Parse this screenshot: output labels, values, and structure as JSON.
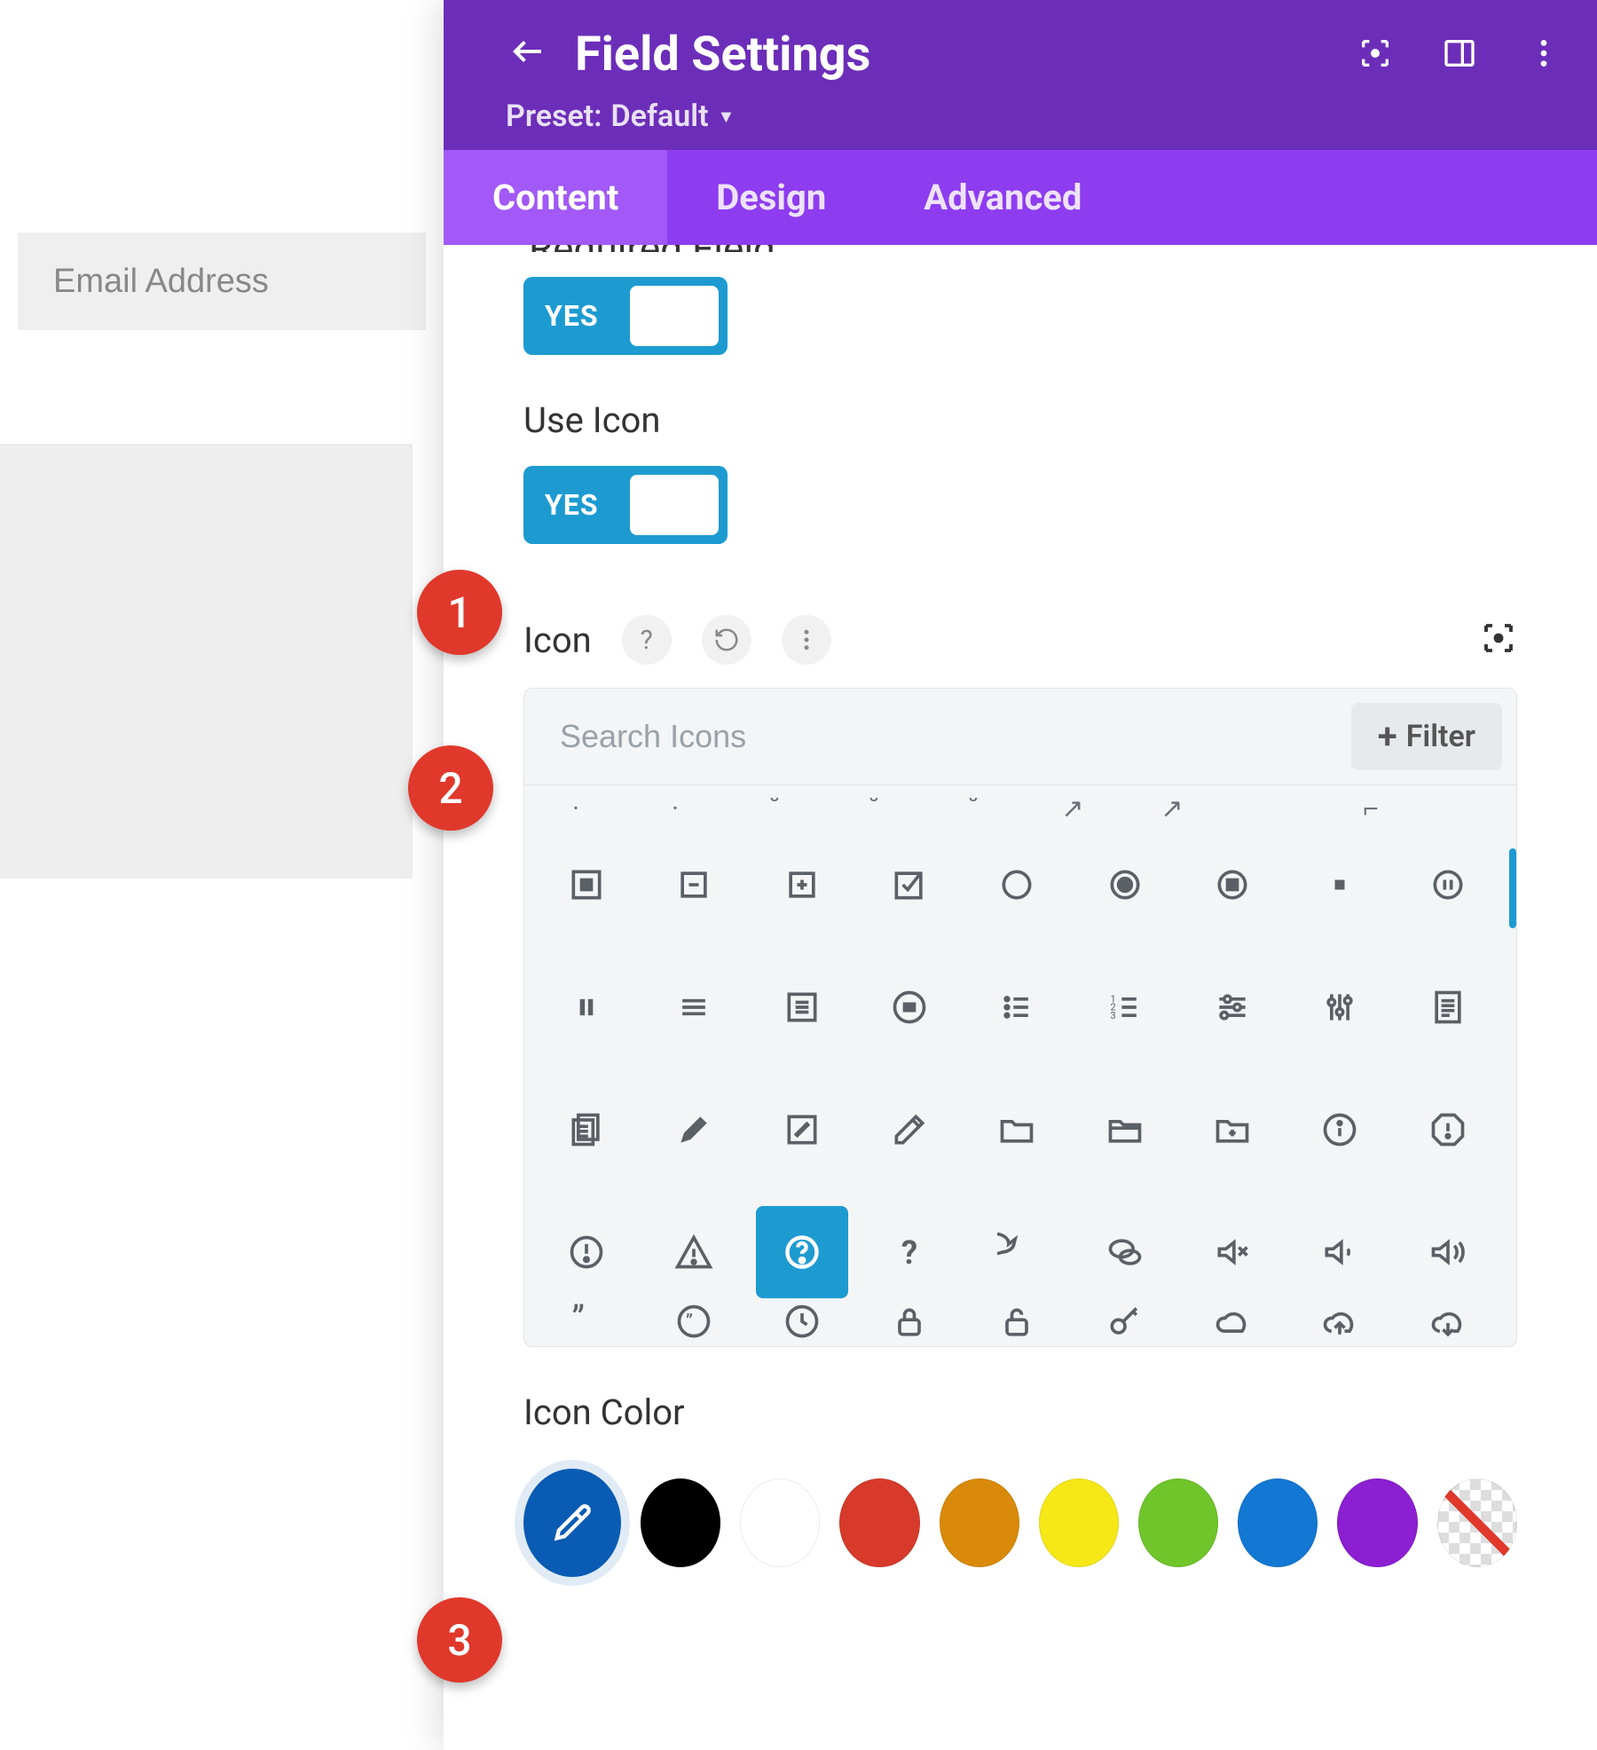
{
  "left": {
    "email_placeholder": "Email Address"
  },
  "header": {
    "title": "Field Settings",
    "preset_prefix": "Preset:",
    "preset": "Default"
  },
  "tabs": {
    "content": "Content",
    "design": "Design",
    "advanced": "Advanced"
  },
  "labels": {
    "required_field": "Required Field",
    "use_icon": "Use Icon",
    "icon": "Icon",
    "icon_color": "Icon Color",
    "yes": "YES",
    "filter": "Filter",
    "search_placeholder": "Search Icons"
  },
  "badges": {
    "one": "1",
    "two": "2",
    "three": "3"
  },
  "palette": {
    "colors": [
      "#000000",
      "#ffffff",
      "#d73a2b",
      "#d98a0a",
      "#f6e817",
      "#6fc52a",
      "#1377d4",
      "#8b1fd1"
    ]
  }
}
